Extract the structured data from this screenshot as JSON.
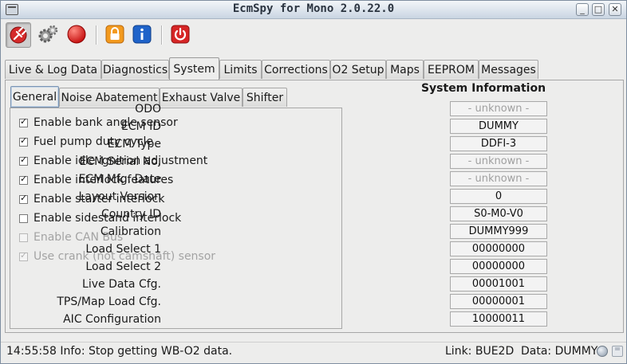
{
  "window": {
    "title": "EcmSpy for Mono 2.0.22.0",
    "min_glyph": "_",
    "max_glyph": "□",
    "close_glyph": "✕"
  },
  "toolbar": {
    "icons": [
      "connect-plug-icon",
      "gears-icon",
      "red-stop-icon",
      "lock-icon",
      "info-icon",
      "power-icon"
    ]
  },
  "tabs": [
    "Live & Log Data",
    "Diagnostics",
    "System",
    "Limits",
    "Corrections",
    "O2 Setup",
    "Maps",
    "EEPROM",
    "Messages"
  ],
  "active_tab": "System",
  "subtabs": [
    "General",
    "Noise Abatement",
    "Exhaust Valve",
    "Shifter"
  ],
  "active_subtab": "General",
  "options": [
    {
      "label": "Enable bank angle sensor",
      "checked": true,
      "enabled": true
    },
    {
      "label": "Fuel pump duty cycle",
      "checked": true,
      "enabled": true
    },
    {
      "label": "Enable idle ignition adjustment",
      "checked": true,
      "enabled": true
    },
    {
      "label": "Enable interlock features",
      "checked": true,
      "enabled": true
    },
    {
      "label": "Enable starter interlock",
      "checked": true,
      "enabled": true
    },
    {
      "label": "Enable sidestand interlock",
      "checked": false,
      "enabled": true
    },
    {
      "label": "Enable CAN Bus",
      "checked": false,
      "enabled": false
    },
    {
      "label": "Use crank (not camshaft) sensor",
      "checked": true,
      "enabled": false
    }
  ],
  "system_info": {
    "title": "System Information",
    "rows": [
      {
        "label": "ODO",
        "value": "- unknown -",
        "unknown": true
      },
      {
        "label": "ECM ID",
        "value": "DUMMY",
        "unknown": false
      },
      {
        "label": "ECM Type",
        "value": "DDFI-3",
        "unknown": false
      },
      {
        "label": "ECM Serial No.",
        "value": "- unknown -",
        "unknown": true
      },
      {
        "label": "ECM Mfg. Date",
        "value": "- unknown -",
        "unknown": true
      },
      {
        "label": "Layout Version",
        "value": "0",
        "unknown": false
      },
      {
        "label": "Country ID",
        "value": "S0-M0-V0",
        "unknown": false
      },
      {
        "label": "Calibration",
        "value": "DUMMY999",
        "unknown": false
      },
      {
        "label": "Load Select 1",
        "value": "00000000",
        "unknown": false
      },
      {
        "label": "Load Select 2",
        "value": "00000000",
        "unknown": false
      },
      {
        "label": "Live Data Cfg.",
        "value": "00001001",
        "unknown": false
      },
      {
        "label": "TPS/Map Load Cfg.",
        "value": "00000001",
        "unknown": false
      },
      {
        "label": "AIC Configuration",
        "value": "10000011",
        "unknown": false
      }
    ]
  },
  "status": {
    "message": "14:55:58 Info: Stop getting WB-O2 data.",
    "link": "Link: BUE2D",
    "data": "Data: DUMMY"
  }
}
